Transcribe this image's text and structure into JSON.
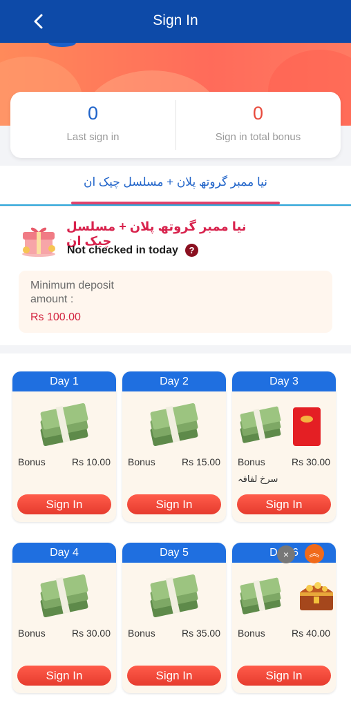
{
  "header": {
    "title": "Sign In",
    "back_icon": "chevron-left-icon"
  },
  "stats": {
    "last_sign_in_value": "0",
    "last_sign_in_label": "Last sign in",
    "total_bonus_value": "0",
    "total_bonus_label": "Sign in total bonus"
  },
  "tab": {
    "label": "نیا ممبر گروتھ پلان + مسلسل چیک ان"
  },
  "plan": {
    "title": "نیا ممبر گروتھ پلان + مسلسل چیک ان",
    "status": "Not checked in today",
    "help": "?",
    "min_deposit_label": "Minimum deposit amount :",
    "min_deposit_value": "Rs 100.00"
  },
  "days": [
    {
      "label": "Day 1",
      "bonus_label": "Bonus",
      "bonus_value": "Rs 10.00",
      "button": "Sign In"
    },
    {
      "label": "Day 2",
      "bonus_label": "Bonus",
      "bonus_value": "Rs 15.00",
      "button": "Sign In"
    },
    {
      "label": "Day 3",
      "bonus_label": "Bonus",
      "bonus_value": "Rs 30.00",
      "extra": "سرخ لفافہ",
      "button": "Sign In"
    },
    {
      "label": "Day 4",
      "bonus_label": "Bonus",
      "bonus_value": "Rs 30.00",
      "button": "Sign In"
    },
    {
      "label": "Day 5",
      "bonus_label": "Bonus",
      "bonus_value": "Rs 35.00",
      "button": "Sign In"
    },
    {
      "label": "Day 6",
      "bonus_label": "Bonus",
      "bonus_value": "Rs 40.00",
      "button": "Sign In"
    }
  ],
  "floating": {
    "close": "×",
    "scroll_top": "︽"
  },
  "colors": {
    "header": "#0d4aa8",
    "accent_blue": "#1f63c9",
    "accent_red": "#e84a3c",
    "button": "#e63b2e"
  }
}
